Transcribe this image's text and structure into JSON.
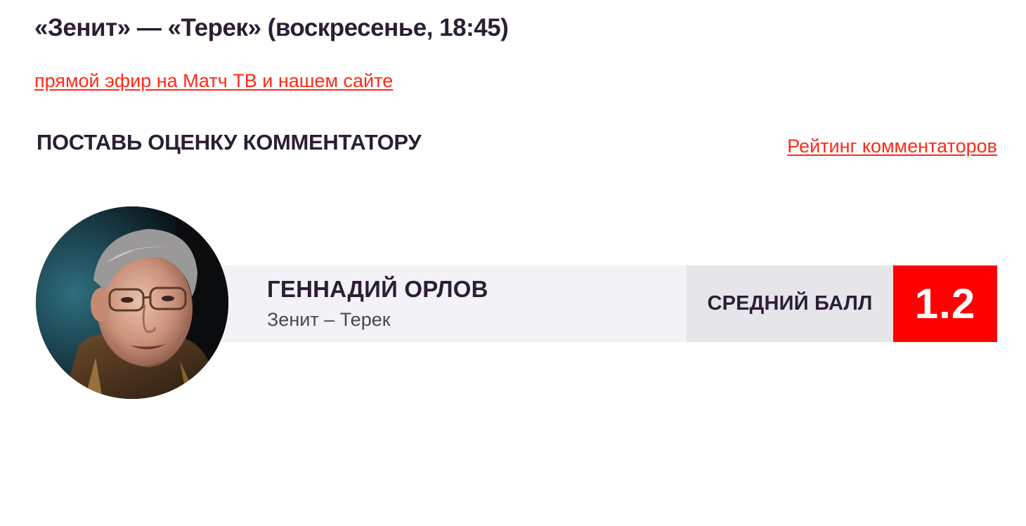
{
  "match": {
    "title": "«Зенит» — «Терек» (воскресенье, 18:45)",
    "broadcast_link": "прямой эфир на Матч ТВ и нашем сайте"
  },
  "rating_section": {
    "heading": "ПОСТАВЬ ОЦЕНКУ КОММЕНТАТОРУ",
    "rating_link": "Рейтинг комментаторов"
  },
  "commentator": {
    "name": "ГЕННАДИЙ ОРЛОВ",
    "match": "Зенит – Терек",
    "avg_label": "СРЕДНИЙ БАЛЛ",
    "avg_score": "1.2",
    "photo_icon": "commentator-photo"
  },
  "colors": {
    "accent_red": "#ff2a1a",
    "score_bg": "#ff0000",
    "text_dark": "#2b1f33",
    "card_bg": "#f3f2f6",
    "avg_bg": "#e6e5ea"
  }
}
